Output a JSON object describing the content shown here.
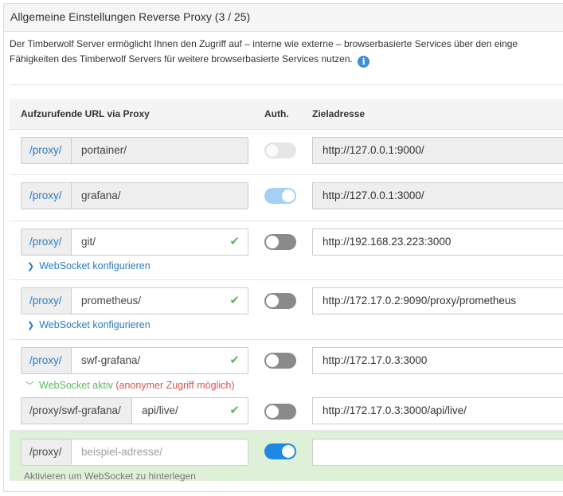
{
  "panel": {
    "title": "Allgemeine Einstellungen Reverse Proxy (3 / 25)",
    "intro_line1": "Der Timberwolf Server ermöglicht Ihnen den Zugriff auf – interne wie externe – browserbasierte Services über den einge",
    "intro_line2": "Fähigkeiten des Timberwolf Servers für weitere browserbasierte Services nutzen.",
    "info_glyph": "i"
  },
  "table": {
    "col_url": "Aufzurufende URL via Proxy",
    "col_auth": "Auth.",
    "col_target": "Zieladresse"
  },
  "rows": [
    {
      "prefix": "/proxy/",
      "path": "portainer/",
      "auth": "off-disabled",
      "target": "http://127.0.0.1:9000/"
    },
    {
      "prefix": "/proxy/",
      "path": "grafana/",
      "auth": "on-disabled",
      "target": "http://127.0.0.1:3000/"
    },
    {
      "prefix": "/proxy/",
      "path": "git/",
      "auth": "off",
      "target": "http://192.168.23.223:3000",
      "ws_label": "WebSocket konfigurieren"
    },
    {
      "prefix": "/proxy/",
      "path": "prometheus/",
      "auth": "off",
      "target": "http://172.17.0.2:9090/proxy/prometheus",
      "ws_label": "WebSocket konfigurieren"
    },
    {
      "prefix": "/proxy/",
      "path": "swf-grafana/",
      "auth": "off",
      "target": "http://172.17.0.3:3000",
      "ws_active": "WebSocket aktiv",
      "ws_warning": "(anonymer Zugriff möglich)"
    },
    {
      "prefix": "/proxy/swf-grafana/",
      "path": "api/live/",
      "auth": "off",
      "target": "http://172.17.0.3:3000/api/live/"
    }
  ],
  "new_row": {
    "prefix": "/proxy/",
    "path_placeholder": "beispiel-adresse/",
    "auth": "on",
    "target": "",
    "hint": "Aktivieren um WebSocket zu hinterlegen"
  },
  "icons": {
    "check": "check-icon",
    "chevron_right": "chevron-right-icon",
    "chevron_down": "chevron-down-icon",
    "info": "info-icon"
  },
  "colors": {
    "link": "#2a7bbf",
    "valid": "#5cb85c",
    "warning": "#d9534f",
    "toggle_on": "#1e88e5",
    "new_row_bg": "#dff0d8"
  }
}
